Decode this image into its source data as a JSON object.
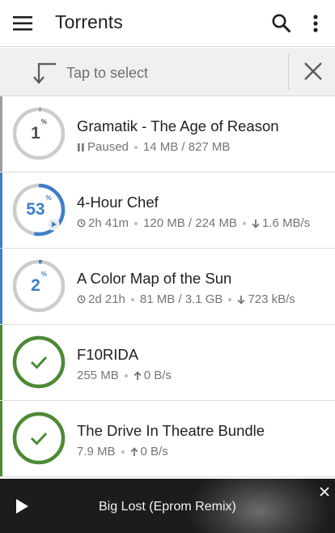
{
  "app_bar": {
    "title": "Torrents",
    "menu_icon": "hamburger-menu-icon",
    "search_icon": "search-icon",
    "overflow_icon": "more-vert-icon"
  },
  "select_bar": {
    "label": "Tap to select",
    "select_icon": "arrow-down-left-icon",
    "close_icon": "close-icon"
  },
  "colors": {
    "paused_gray": "#bdbdbd",
    "downloading_blue": "#3f7fc8",
    "complete_green": "#4c8a36",
    "ring_track": "#cccccc"
  },
  "torrents": [
    {
      "name": "Gramatik - The Age of Reason",
      "percent": "1",
      "percent_sign": "%",
      "progress": 0.01,
      "state": "paused",
      "status_text": "Paused",
      "size": "14 MB / 827 MB"
    },
    {
      "name": "4-Hour Chef",
      "percent": "53",
      "percent_sign": "%",
      "progress": 0.53,
      "state": "downloading",
      "eta": "2h 41m",
      "size": "120 MB / 224 MB",
      "speed": "1.6 MB/s"
    },
    {
      "name": "A Color Map of the Sun",
      "percent": "2",
      "percent_sign": "%",
      "progress": 0.02,
      "state": "downloading",
      "eta": "2d 21h",
      "size": "81 MB / 3.1 GB",
      "speed": "723 kB/s"
    },
    {
      "name": "F10RIDA",
      "progress": 1.0,
      "state": "complete",
      "size": "255 MB",
      "speed": "0 B/s"
    },
    {
      "name": "The Drive In Theatre Bundle",
      "progress": 1.0,
      "state": "complete",
      "size": "7.9 MB",
      "speed": "0 B/s"
    }
  ],
  "player": {
    "track": "Big Lost (Eprom Remix)",
    "play_icon": "play-icon",
    "dismiss_icon": "close-icon"
  }
}
